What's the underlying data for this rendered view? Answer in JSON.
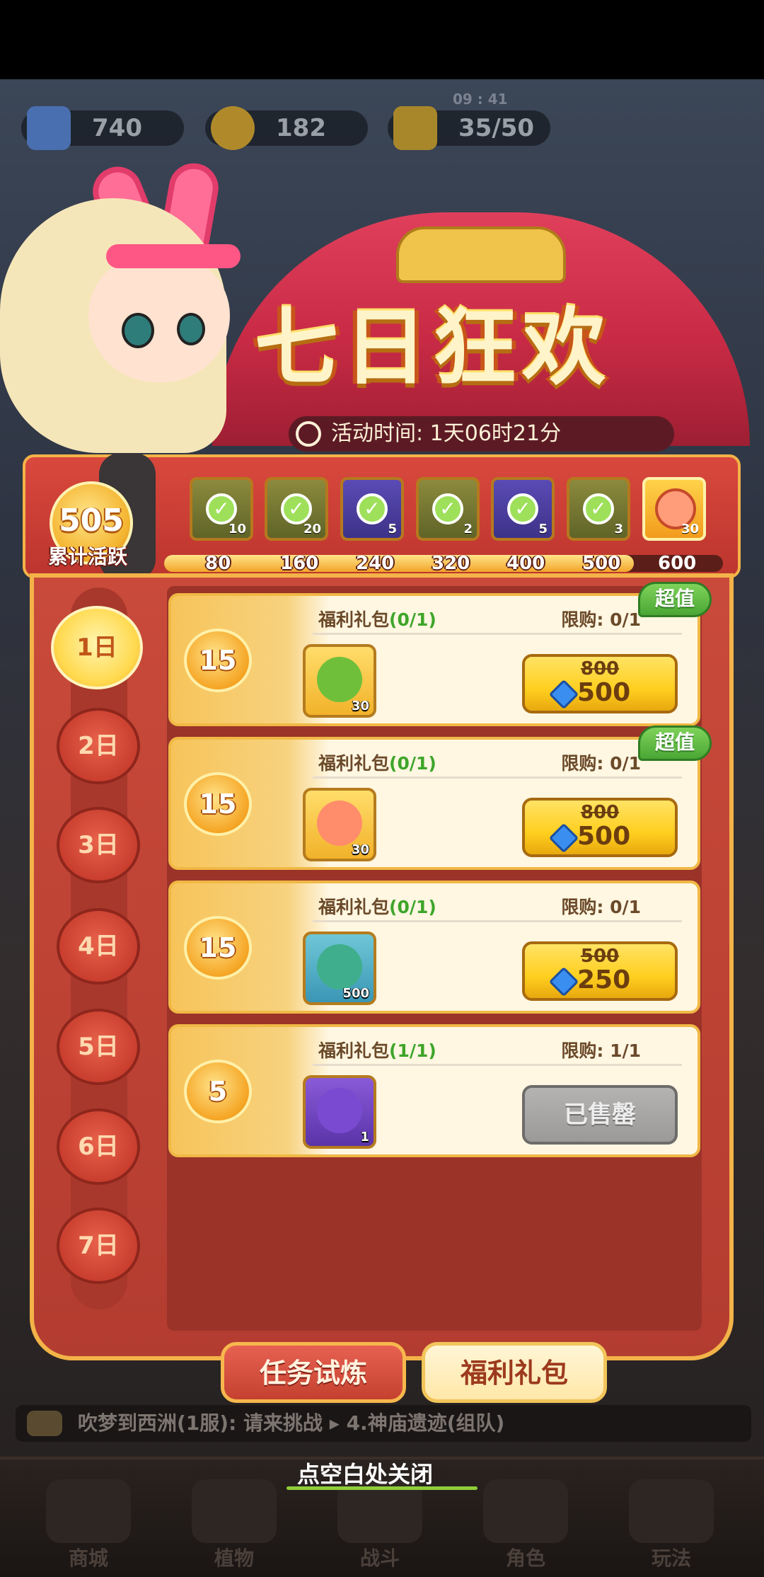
{
  "status_bar": {
    "resources": [
      {
        "name": "diamond",
        "value": "740"
      },
      {
        "name": "coin",
        "value": "182"
      },
      {
        "name": "energy",
        "value": "35/50"
      }
    ],
    "timer": "09 : 41"
  },
  "event": {
    "title": "七日狂欢",
    "time_label": "活动时间: 1天06时21分"
  },
  "activity": {
    "points": "505",
    "label": "累计活跃",
    "progress": 0.84,
    "milestones": [
      {
        "threshold": "80",
        "reward_count": "10",
        "claimed": true,
        "style": "olive"
      },
      {
        "threshold": "160",
        "reward_count": "20",
        "claimed": true,
        "style": "olive"
      },
      {
        "threshold": "240",
        "reward_count": "5",
        "claimed": true,
        "style": "purple"
      },
      {
        "threshold": "320",
        "reward_count": "2",
        "claimed": true,
        "style": "olive"
      },
      {
        "threshold": "400",
        "reward_count": "5",
        "claimed": true,
        "style": "purple"
      },
      {
        "threshold": "500",
        "reward_count": "3",
        "claimed": true,
        "style": "olive"
      },
      {
        "threshold": "600",
        "reward_count": "30",
        "claimed": false,
        "style": "gold"
      }
    ]
  },
  "days": [
    {
      "label": "1日",
      "active": true
    },
    {
      "label": "2日",
      "active": false
    },
    {
      "label": "3日",
      "active": false
    },
    {
      "label": "4日",
      "active": false
    },
    {
      "label": "5日",
      "active": false
    },
    {
      "label": "6日",
      "active": false
    },
    {
      "label": "7日",
      "active": false
    }
  ],
  "packages": [
    {
      "points": "15",
      "name": "福利礼包",
      "progress": "(0/1)",
      "limit": "限购: 0/1",
      "item_count": "30",
      "item_color": "#6fbf3a",
      "old_price": "800",
      "price": "500",
      "sold_out": false,
      "tag": "超值"
    },
    {
      "points": "15",
      "name": "福利礼包",
      "progress": "(0/1)",
      "limit": "限购: 0/1",
      "item_count": "30",
      "item_color": "#ff8c6a",
      "old_price": "800",
      "price": "500",
      "sold_out": false,
      "tag": "超值"
    },
    {
      "points": "15",
      "name": "福利礼包",
      "progress": "(0/1)",
      "limit": "限购: 0/1",
      "item_count": "500",
      "item_color": "#3fae8c",
      "old_price": "500",
      "price": "250",
      "sold_out": false,
      "tag": ""
    },
    {
      "points": "5",
      "name": "福利礼包",
      "progress": "(1/1)",
      "limit": "限购: 1/1",
      "item_count": "1",
      "item_color": "#7a4bd0",
      "old_price": "",
      "price": "",
      "sold_out": true,
      "sold_label": "已售罄",
      "tag": ""
    }
  ],
  "tabs": {
    "tasks": "任务试炼",
    "gifts": "福利礼包"
  },
  "chat": {
    "message": "吹梦到西洲(1服): 请来挑战 ▸ 4.神庙遗迹(组队)"
  },
  "close_hint": "点空白处关闭",
  "bottom_nav": [
    "商城",
    "植物",
    "战斗",
    "角色",
    "玩法"
  ]
}
